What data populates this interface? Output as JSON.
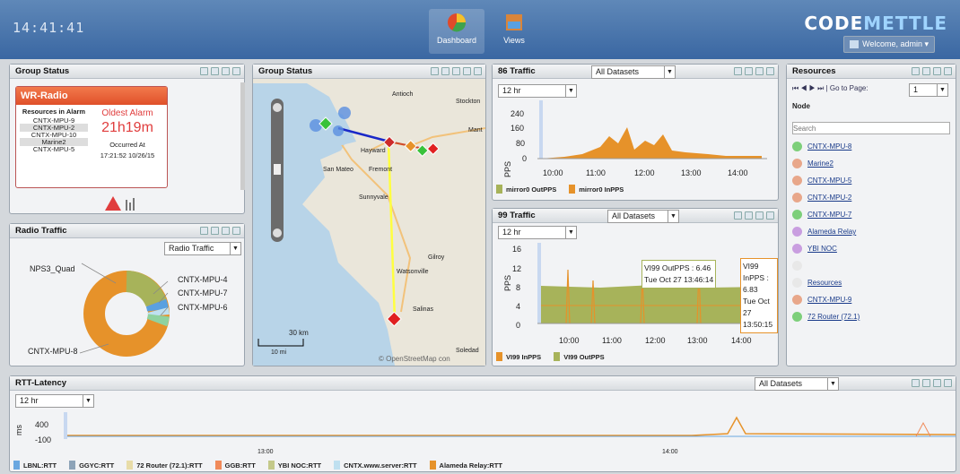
{
  "header": {
    "clock": "14:41:41",
    "nav": [
      {
        "label": "Dashboard"
      },
      {
        "label": "Views"
      }
    ],
    "brand_a": "CODE",
    "brand_b": "METTLE",
    "welcome": "Welcome, admin"
  },
  "group_status_1": {
    "title": "Group Status",
    "card_title": "WR-Radio",
    "resources_label": "Resources in Alarm",
    "resources": [
      "CNTX-MPU-9",
      "CNTX-MPU-2",
      "CNTX-MPU-10",
      "Marine2",
      "CNTX-MPU-5"
    ],
    "oldest_label": "Oldest Alarm",
    "oldest_value": "21h19m",
    "occurred_label": "Occurred At",
    "occurred_value": "17:21:52 10/26/15"
  },
  "group_status_map": {
    "title": "Group Status",
    "places": [
      "Antioch",
      "Stockton",
      "Hayward",
      "San Mateo",
      "Fremont",
      "Sunnyvale",
      "Gilroy",
      "Watsonville",
      "Salinas",
      "Soledad",
      "Mant"
    ],
    "scale_km": "30 km",
    "scale_mi": "10 mi",
    "credit": "© OpenStreetMap con"
  },
  "traffic86": {
    "title": "86 Traffic",
    "dataset": "All Datasets",
    "range": "12 hr",
    "ylabel": "PPS",
    "yticks": [
      "240",
      "160",
      "80",
      "0"
    ],
    "xticks": [
      "10:00",
      "11:00",
      "12:00",
      "13:00",
      "14:00"
    ],
    "legend": [
      {
        "name": "mirror0 OutPPS",
        "color": "#a7b35a"
      },
      {
        "name": "mirror0 InPPS",
        "color": "#e6922a"
      }
    ]
  },
  "traffic99": {
    "title": "99 Traffic",
    "dataset": "All Datasets",
    "range": "12 hr",
    "ylabel": "PPS",
    "yticks": [
      "16",
      "12",
      "8",
      "4",
      "0"
    ],
    "xticks": [
      "10:00",
      "11:00",
      "12:00",
      "13:00",
      "14:00"
    ],
    "legend": [
      {
        "name": "VI99 InPPS",
        "color": "#e6922a"
      },
      {
        "name": "VI99 OutPPS",
        "color": "#a7b35a"
      }
    ],
    "tip1": [
      "VI99 OutPPS : 6.46",
      "Tue Oct 27 13:46:14"
    ],
    "tip2": [
      "VI99 InPPS : 6.83",
      "Tue Oct 27 13:50:15"
    ]
  },
  "radio": {
    "title": "Radio Traffic",
    "select": "Radio Traffic",
    "labels": [
      "NPS3_Quad",
      "CNTX-MPU-4",
      "CNTX-MPU-7",
      "CNTX-MPU-6",
      "CNTX-MPU-8"
    ]
  },
  "resources": {
    "title": "Resources",
    "goto": "Go to Page:",
    "page": "1",
    "col": "Node",
    "search_placeholder": "Search",
    "items": [
      {
        "name": "CNTX-MPU-8",
        "color": "#7dcf7a"
      },
      {
        "name": "Marine2",
        "color": "#e8a78a"
      },
      {
        "name": "CNTX-MPU-5",
        "color": "#e8a78a"
      },
      {
        "name": "CNTX-MPU-2",
        "color": "#e8a78a"
      },
      {
        "name": "CNTX-MPU-7",
        "color": "#7dcf7a"
      },
      {
        "name": "Alameda Relay",
        "color": "#c99ee0"
      },
      {
        "name": "YBI NOC",
        "color": "#c99ee0"
      },
      {
        "name": "",
        "color": "#e8e8e8"
      },
      {
        "name": "Resources",
        "color": "#e8e8e8"
      },
      {
        "name": "CNTX-MPU-9",
        "color": "#e8a78a"
      },
      {
        "name": "72 Router (72.1)",
        "color": "#7dcf7a"
      }
    ]
  },
  "rtt": {
    "title": "RTT-Latency",
    "range": "12 hr",
    "dataset": "All Datasets",
    "ylabel": "ms",
    "yticks": [
      "400",
      "-100"
    ],
    "xticks": [
      "13:00",
      "14:00"
    ],
    "legend": [
      {
        "name": "LBNL:RTT",
        "color": "#6aa7e0"
      },
      {
        "name": "GGYC:RTT",
        "color": "#8da3b8"
      },
      {
        "name": "72 Router (72.1):RTT",
        "color": "#e8dca8"
      },
      {
        "name": "GGB:RTT",
        "color": "#f08a5a"
      },
      {
        "name": "YBI NOC:RTT",
        "color": "#c4c98a"
      },
      {
        "name": "CNTX.www.server:RTT",
        "color": "#bfe0f0"
      },
      {
        "name": "Alameda Relay:RTT",
        "color": "#e6922a"
      }
    ]
  }
}
